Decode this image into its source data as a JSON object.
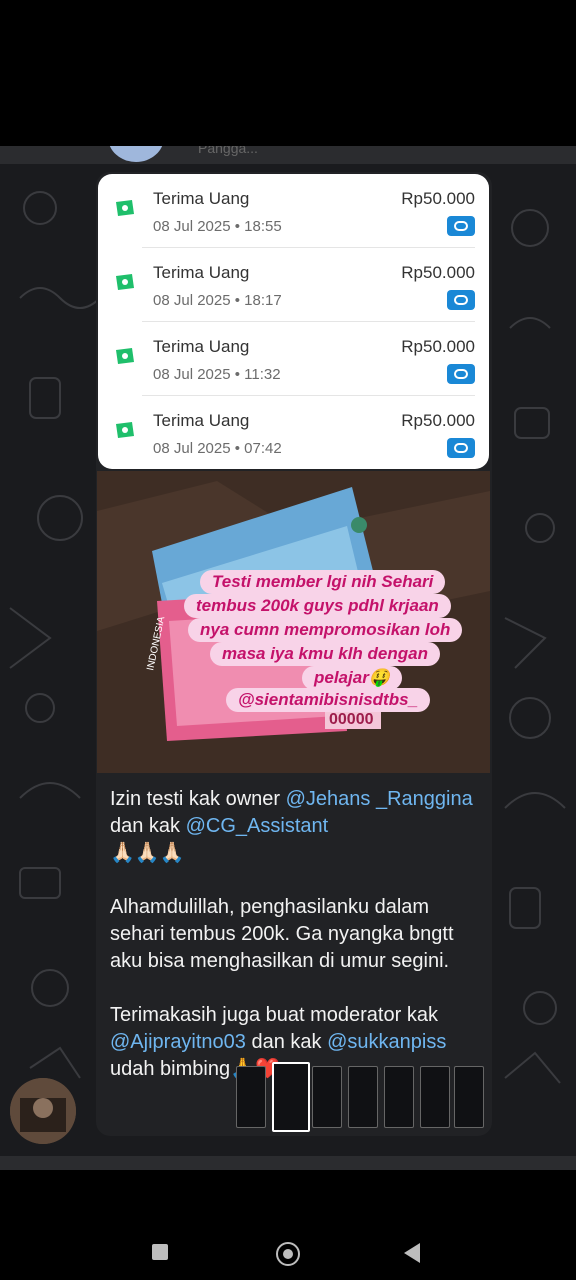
{
  "chat": {
    "header_text": "Pangga..."
  },
  "transactions": [
    {
      "title": "Terima Uang",
      "date": "08 Jul 2025 • 18:55",
      "amount": "Rp50.000"
    },
    {
      "title": "Terima Uang",
      "date": "08 Jul 2025 • 18:17",
      "amount": "Rp50.000"
    },
    {
      "title": "Terima Uang",
      "date": "08 Jul 2025 • 11:32",
      "amount": "Rp50.000"
    },
    {
      "title": "Terima Uang",
      "date": "08 Jul 2025 • 07:42",
      "amount": "Rp50.000"
    }
  ],
  "photo_overlay": {
    "lines": [
      "Testi member lgi nih Sehari",
      "tembus 200k guys pdhl krjaan",
      "nya cumn mempromosikan loh",
      "masa iya kmu klh dengan",
      "pelajar🤑",
      "@sientamibisnisdtbs_"
    ],
    "banknote_text": "00000",
    "banknote_country": "INDONESIA"
  },
  "message": {
    "line1_prefix": "Izin testi kak owner ",
    "mention_owner": "@Jehans _Ranggina",
    "line1_mid": " dan kak ",
    "mention_assistant": "@CG_Assistant",
    "emoji_line": "🙏🏻🙏🏻🙏🏻",
    "paragraph2": "Alhamdulillah, penghasilanku dalam sehari tembus 200k. Ga nyangka bngtt aku bisa menghasilkan di umur segini.",
    "para3_prefix": "Terimakasih juga buat moderator kak ",
    "mention_moderator": "@Ajiprayitno03",
    "para3_mid": " dan kak ",
    "mention_second": "@sukkanpiss",
    "para3_tail": " udah bimbing🙏❤️"
  },
  "colors": {
    "mention": "#6fb6f0",
    "overlay_bg": "#f8d3e8",
    "overlay_text": "#c4126a",
    "badge": "#1a88d6",
    "money_icon": "#1fbf6b"
  }
}
